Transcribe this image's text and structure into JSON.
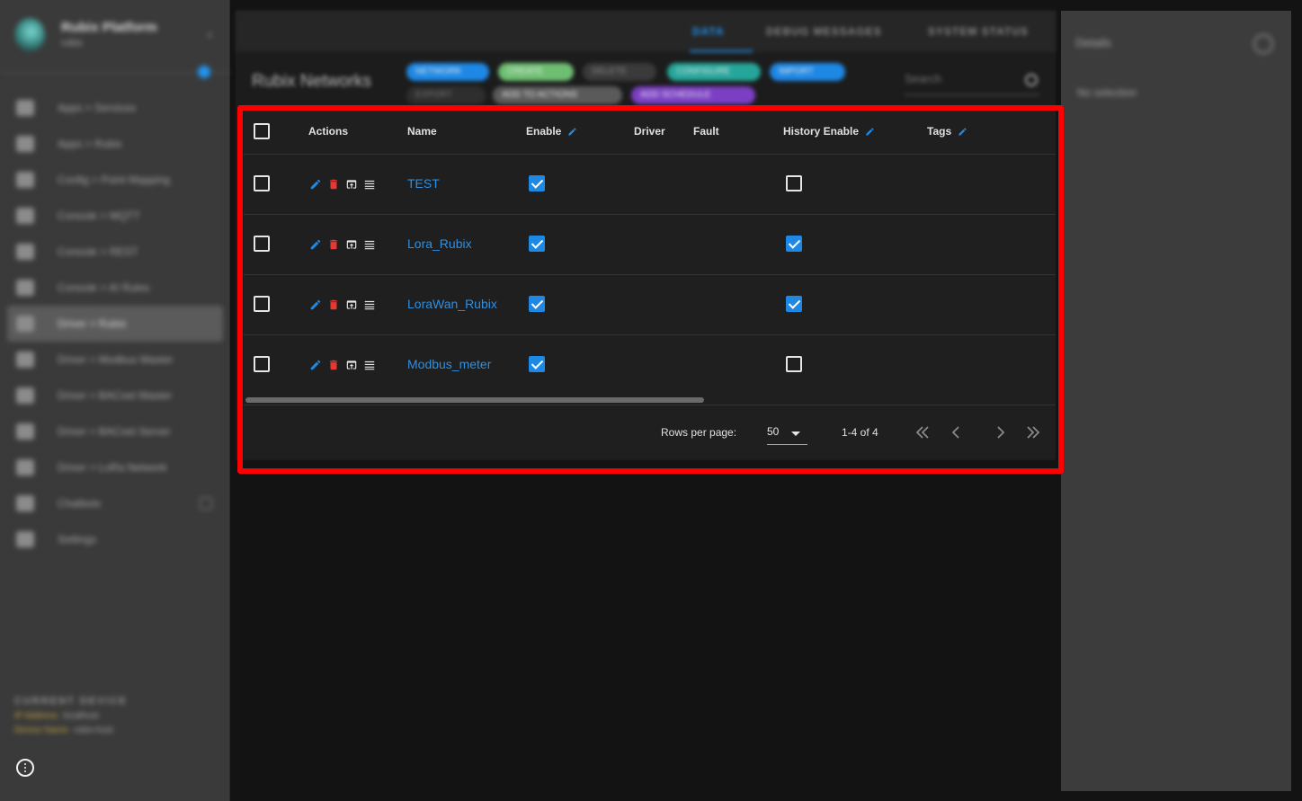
{
  "sidebar": {
    "app_title": "Rubix Platform",
    "app_subtitle": "rubix",
    "items": [
      {
        "label": "Apps > Services",
        "icon": "grid-icon"
      },
      {
        "label": "Apps > Rubix",
        "icon": "apps-icon"
      },
      {
        "label": "Config > Point Mapping",
        "icon": "mapping-icon"
      },
      {
        "label": "Console > MQTT",
        "icon": "mqtt-icon"
      },
      {
        "label": "Console > REST",
        "icon": "rest-icon"
      },
      {
        "label": "Console > AI Rules",
        "icon": "rules-icon"
      },
      {
        "label": "Driver > Rubix",
        "icon": "cloud-icon",
        "active": true
      },
      {
        "label": "Driver > Modbus Master",
        "icon": "modbus-icon"
      },
      {
        "label": "Driver > BACnet Master",
        "icon": "bacnet-icon"
      },
      {
        "label": "Driver > BACnet Server",
        "icon": "server-icon"
      },
      {
        "label": "Driver > LoRa Network",
        "icon": "lora-icon"
      },
      {
        "label": "Chatbots",
        "icon": "chat-icon"
      },
      {
        "label": "Settings",
        "icon": "settings-icon"
      }
    ],
    "footer": {
      "title": "CURRENT DEVICE",
      "rows": [
        {
          "key": "IP Address",
          "value": "localhost"
        },
        {
          "key": "Device Name",
          "value": "rubix-host"
        }
      ]
    }
  },
  "topbar": {
    "tabs": [
      "DATA",
      "DEBUG MESSAGES",
      "SYSTEM STATUS"
    ]
  },
  "subhead": {
    "page_title": "Rubix Networks",
    "chips": [
      "NETWORK",
      "CREATE",
      "DELETE",
      "CONFIGURE",
      "IMPORT",
      "EXPORT",
      "ADD TO ACTIONS",
      "ADD SCHEDULE"
    ],
    "search_placeholder": "Search"
  },
  "rightpanel": {
    "label": "Details",
    "item": "No selection"
  },
  "table": {
    "columns": {
      "actions": "Actions",
      "name": "Name",
      "enable": "Enable",
      "driver": "Driver",
      "fault": "Fault",
      "history_enable": "History Enable",
      "tags": "Tags"
    },
    "rows": [
      {
        "name": "TEST",
        "enable": true,
        "history_enable": false
      },
      {
        "name": "Lora_Rubix",
        "enable": true,
        "history_enable": true
      },
      {
        "name": "LoraWan_Rubix",
        "enable": true,
        "history_enable": true
      },
      {
        "name": "Modbus_meter",
        "enable": true,
        "history_enable": false
      }
    ]
  },
  "pagination": {
    "rows_per_page_label": "Rows per page:",
    "rows_per_page": "50",
    "range": "1-4 of 4"
  },
  "colors": {
    "accent": "#1e88e5",
    "link": "#2f8fe0",
    "delete": "#e53935",
    "highlight": "#ff0000"
  }
}
